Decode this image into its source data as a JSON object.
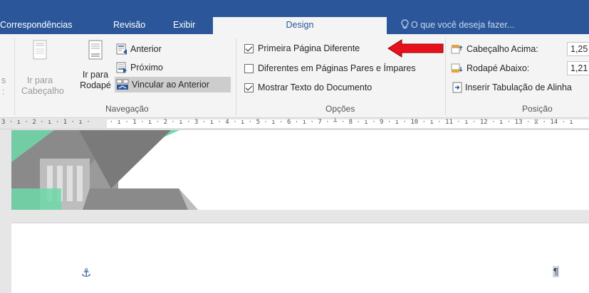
{
  "tabs": {
    "correspondencias": "Correspondências",
    "revisao": "Revisão",
    "exibir": "Exibir",
    "design": "Design",
    "tell_me": "O que você deseja fazer..."
  },
  "navegacao": {
    "left_cut_1": "s",
    "left_cut_2": ":",
    "ir_cabecalho_1": "Ir para",
    "ir_cabecalho_2": "Cabeçalho",
    "ir_rodape_1": "Ir para",
    "ir_rodape_2": "Rodapé",
    "anterior": "Anterior",
    "proximo": "Próximo",
    "vincular": "Vincular ao Anterior",
    "label": "Navegação"
  },
  "opcoes": {
    "primeira": "Primeira Página Diferente",
    "pares_impares": "Diferentes em Páginas Pares e Ímpares",
    "mostrar_texto": "Mostrar Texto do Documento",
    "label": "Opções",
    "checked": {
      "primeira": true,
      "pares_impares": false,
      "mostrar_texto": true
    }
  },
  "posicao": {
    "cabecalho_acima": "Cabeçalho Acima:",
    "cabecalho_value": "1,25",
    "rodape_abaixo": "Rodapé Abaixo:",
    "rodape_value": "1,21",
    "inserir_tab": "Inserir Tabulação de Alinha",
    "label": "Posição"
  },
  "ruler": {
    "text": "3 · ı · 2 · ı · 1 · ı ·     · ı · 1 · ı · 2 · ı · 3 · ı · 4 · ı · 5 · ı · 6 · ı · 7 · ┴ · 8 · ı · 9 · ı · 10 · ı · 11 · ı · 12 · ı · 13 · ⧖ · 14 · ı"
  },
  "colors": {
    "brand": "#2b579a",
    "arrow": "#e8101a",
    "green": "#6dd8a8",
    "gray": "#7a7a7a"
  }
}
